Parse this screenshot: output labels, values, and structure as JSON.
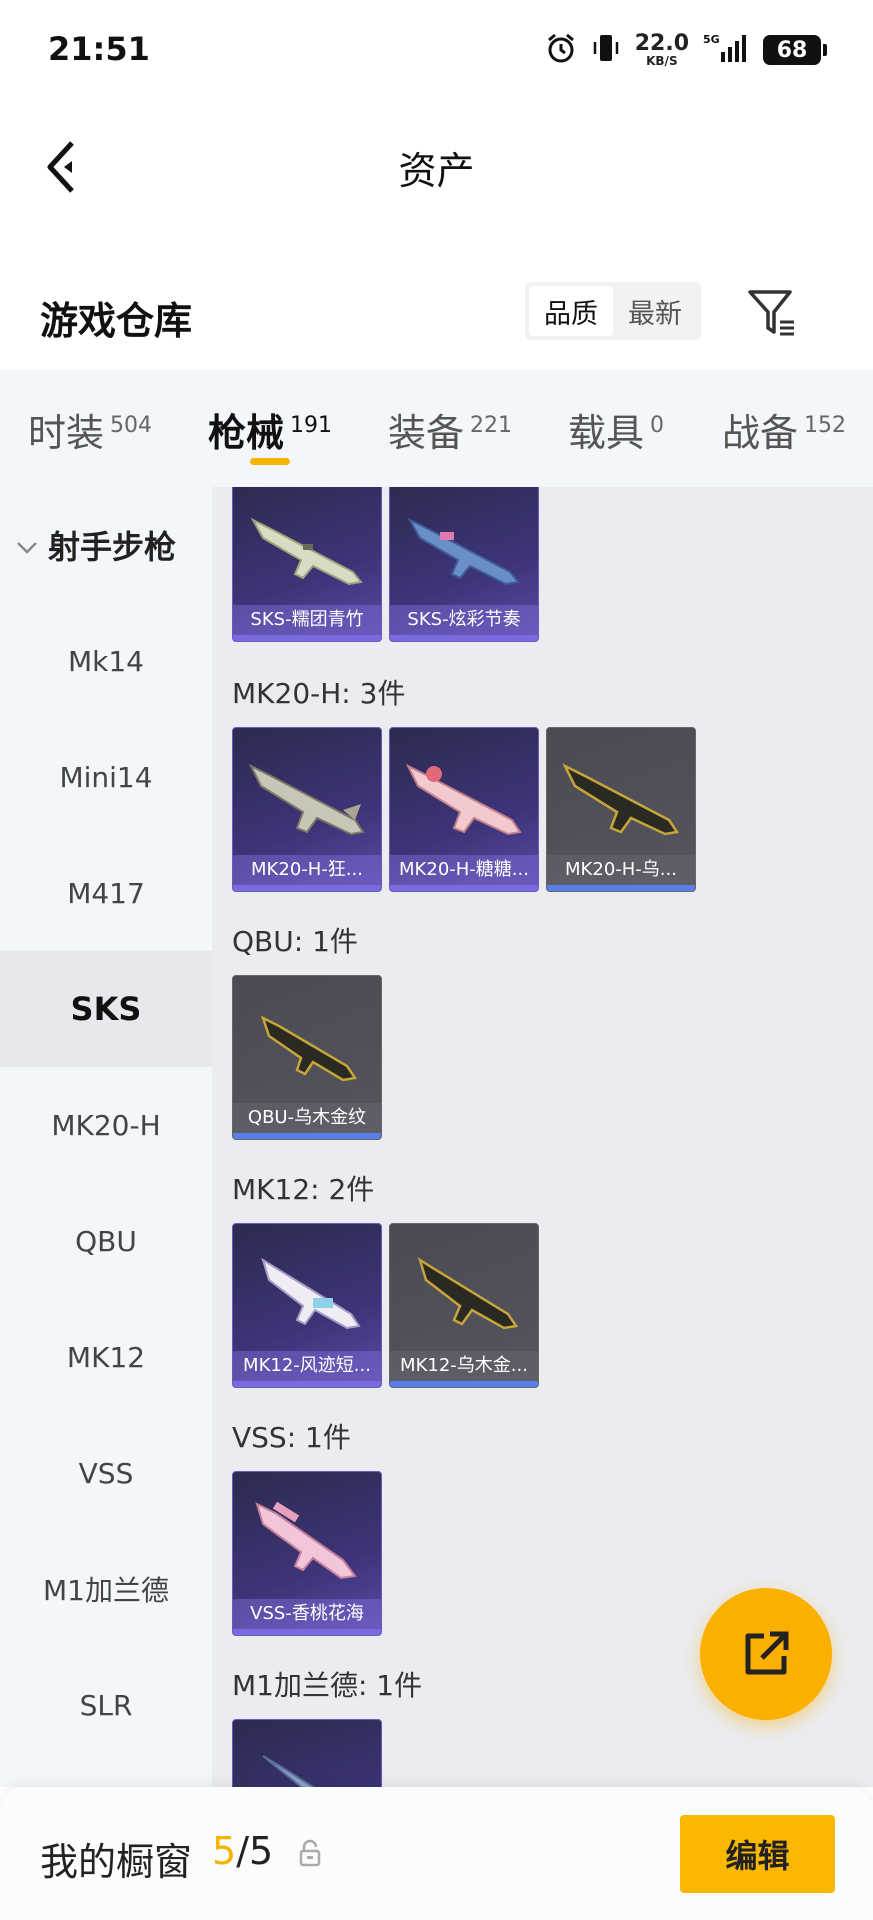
{
  "status_bar": {
    "time": "21:51",
    "net_speed": "22.0",
    "net_unit": "KB/S",
    "signal": "5G",
    "battery": "68"
  },
  "nav": {
    "title": "资产"
  },
  "warehouse": {
    "title": "游戏仓库",
    "sort_options": [
      "品质",
      "最新"
    ],
    "sort_selected": "品质"
  },
  "tabs": [
    {
      "label": "时装",
      "count": "504"
    },
    {
      "label": "枪械",
      "count": "191",
      "active": true
    },
    {
      "label": "装备",
      "count": "221"
    },
    {
      "label": "载具",
      "count": "0"
    },
    {
      "label": "战备",
      "count": "152"
    }
  ],
  "sidebar": {
    "group": "射手步枪",
    "items": [
      "Mk14",
      "Mini14",
      "M417",
      "SKS",
      "MK20-H",
      "QBU",
      "MK12",
      "VSS",
      "M1加兰德",
      "SLR"
    ],
    "active": "SKS"
  },
  "content": {
    "sks_cards": [
      "SKS-糯团青竹",
      "SKS-炫彩节奏"
    ],
    "groups": [
      {
        "title": "MK20-H: 3件",
        "cards": [
          "MK20-H-狂...",
          "MK20-H-糖糖...",
          "MK20-H-乌..."
        ]
      },
      {
        "title": "QBU: 1件",
        "cards": [
          "QBU-乌木金纹"
        ]
      },
      {
        "title": "MK12: 2件",
        "cards": [
          "MK12-风迹短...",
          "MK12-乌木金..."
        ]
      },
      {
        "title": "VSS: 1件",
        "cards": [
          "VSS-香桃花海"
        ]
      },
      {
        "title": "M1加兰德: 1件",
        "cards": []
      }
    ]
  },
  "bottom": {
    "label": "我的橱窗",
    "current": "5",
    "separator": "/",
    "max": "5",
    "edit_label": "编辑"
  },
  "colors": {
    "accent": "#fbb800",
    "purple_card": "#3d3478",
    "grey_card": "#55565d"
  }
}
